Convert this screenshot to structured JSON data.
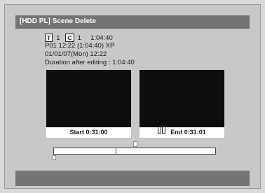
{
  "title": "[HDD PL] Scene Delete",
  "info": {
    "title_badge": "T",
    "title_number": "1",
    "chapter_badge": "C",
    "chapter_number": "1",
    "total_time": "1:04:40",
    "program_line": "P01  12:22 (1:04:40) XP",
    "date_line": "01/01/07(Mon)  12:22",
    "duration_line": "Duration after editing : 1:04:40"
  },
  "preview": {
    "start_label": "Start  0:31:00",
    "end_label": "End  0:31:01"
  },
  "timeline": {
    "start_fraction": 0.38,
    "cursor_fraction": 0.49
  },
  "colors": {
    "titlebar": "#747474",
    "screen": "#0d0d0d",
    "background": "#c8c8c8"
  }
}
